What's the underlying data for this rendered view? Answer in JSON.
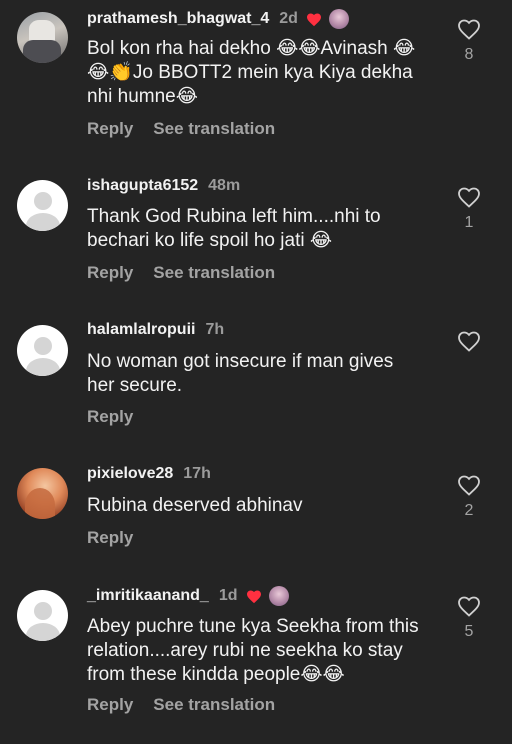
{
  "comments": [
    {
      "username": "prathamesh_bhagwat_4",
      "time": "2d",
      "lines": [
        "Bol kon rha hai dekho 😂😂Avinash 😂",
        "😂👏Jo BBOTT2 mein kya Kiya dekha",
        "nhi humne😂"
      ],
      "reply_label": "Reply",
      "translate_label": "See translation",
      "likes": "8"
    },
    {
      "username": "ishagupta6152",
      "time": "48m",
      "lines": [
        "Thank God Rubina left him....nhi to",
        "bechari ko life spoil ho jati 😂"
      ],
      "reply_label": "Reply",
      "translate_label": "See translation",
      "likes": "1"
    },
    {
      "username": "halamlalropuii",
      "time": "7h",
      "lines": [
        "No woman got insecure if man gives",
        "her secure."
      ],
      "reply_label": "Reply",
      "likes": ""
    },
    {
      "username": "pixielove28",
      "time": "17h",
      "lines": [
        "Rubina deserved abhinav"
      ],
      "reply_label": "Reply",
      "likes": "2"
    },
    {
      "username": "_imritikaanand_",
      "time": "1d",
      "lines": [
        "Abey puchre tune kya Seekha from this",
        "relation....arey rubi ne seekha ko stay",
        "from these kindda people😂😂"
      ],
      "reply_label": "Reply",
      "translate_label": "See translation",
      "likes": "5"
    }
  ],
  "colors": {
    "background": "#242424",
    "creator_heart": "#ff3040",
    "muted": "#a3a3a3"
  },
  "icons": {
    "like": "heart-outline-icon",
    "creator_like": "heart-filled-icon",
    "avatar_placeholder": "default-avatar-icon"
  }
}
